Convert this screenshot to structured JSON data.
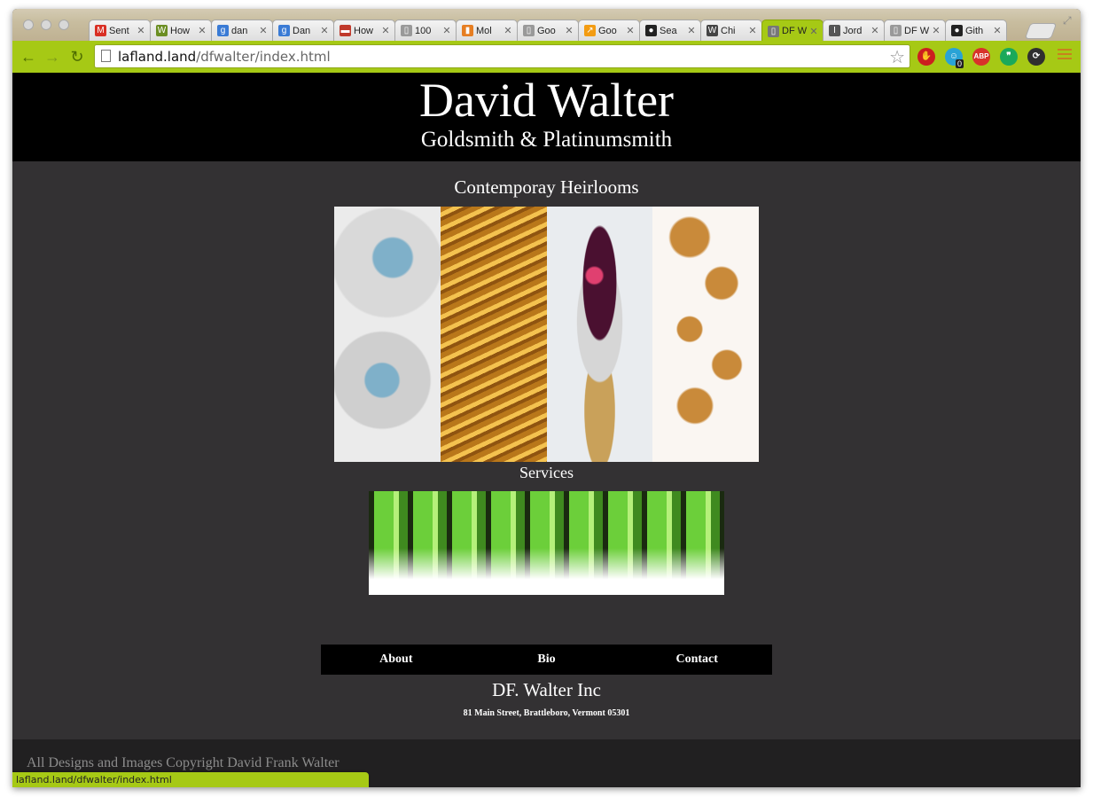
{
  "browser": {
    "tabs": [
      {
        "label": "Sent",
        "icon": "gmail-icon",
        "icon_text": "M",
        "icon_color": "#d93025"
      },
      {
        "label": "How",
        "icon": "wikihow-icon",
        "icon_text": "W",
        "icon_color": "#6b8e23"
      },
      {
        "label": "dan",
        "icon": "google-search-icon",
        "icon_text": "g",
        "icon_color": "#3a7bd5"
      },
      {
        "label": "Dan",
        "icon": "google-search-icon",
        "icon_text": "g",
        "icon_color": "#3a7bd5"
      },
      {
        "label": "How",
        "icon": "flag-icon",
        "icon_text": "▬",
        "icon_color": "#c0392b"
      },
      {
        "label": "100",
        "icon": "page-icon",
        "icon_text": "▯",
        "icon_color": "#999999"
      },
      {
        "label": "Mol",
        "icon": "chart-icon",
        "icon_text": "▮",
        "icon_color": "#e67e22"
      },
      {
        "label": "Goo",
        "icon": "page-icon",
        "icon_text": "▯",
        "icon_color": "#999999"
      },
      {
        "label": "Goo",
        "icon": "analytics-icon",
        "icon_text": "↗",
        "icon_color": "#f39c12"
      },
      {
        "label": "Sea",
        "icon": "github-icon",
        "icon_text": "●",
        "icon_color": "#222222"
      },
      {
        "label": "Chi",
        "icon": "wikipedia-icon",
        "icon_text": "W",
        "icon_color": "#444444"
      },
      {
        "label": "DF W",
        "icon": "page-icon",
        "icon_text": "▯",
        "icon_color": "#777777",
        "active": true
      },
      {
        "label": "Jord",
        "icon": "font-icon",
        "icon_text": "I",
        "icon_color": "#555555"
      },
      {
        "label": "DF W",
        "icon": "page-icon",
        "icon_text": "▯",
        "icon_color": "#999999"
      },
      {
        "label": "Gith",
        "icon": "github-icon",
        "icon_text": "●",
        "icon_color": "#222222"
      }
    ],
    "url_host": "lafland.land",
    "url_path": "/dfwalter/index.html",
    "extensions": [
      {
        "name": "stop-extension-icon",
        "text": "✋",
        "color": "#cc1f1f"
      },
      {
        "name": "badge-extension-icon",
        "text": "☺",
        "color": "#29a3d6"
      },
      {
        "name": "adblock-icon",
        "text": "ABP",
        "color": "#d8322a"
      },
      {
        "name": "hangouts-icon",
        "text": "❞",
        "color": "#1aa95a"
      },
      {
        "name": "sync-extension-icon",
        "text": "⟳",
        "color": "#2f2f2f"
      }
    ],
    "extension_badge": "0",
    "status_url": "lafland.land/dfwalter/index.html"
  },
  "site": {
    "title": "David Walter",
    "subtitle": "Goldsmith & Platinumsmith",
    "section_heirlooms": "Contemporay Heirlooms",
    "section_services": "Services",
    "nav": [
      "About",
      "Bio",
      "Contact"
    ],
    "company": "DF. Walter Inc",
    "address": "81 Main Street, Brattleboro, Vermont 05301",
    "copyright": "All Designs and Images Copyright David Frank Walter"
  },
  "colors": {
    "chrome_accent": "#a6c915",
    "page_background": "#333133",
    "header_background": "#000000",
    "footer_background": "#212021"
  }
}
